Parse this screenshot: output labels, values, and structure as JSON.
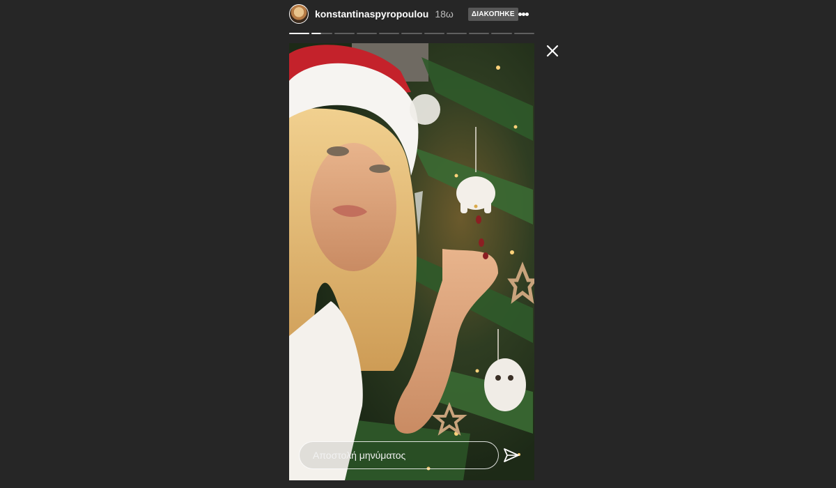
{
  "story": {
    "username": "konstantinaspyropoulou",
    "time_ago": "18ω",
    "paused_badge": "ΔΙΑΚΟΠΗΚΕ",
    "segments_total": 11,
    "current_segment": 2,
    "current_segment_progress": 0.45
  },
  "reply": {
    "placeholder": "Αποστολή μηνύματος"
  },
  "icons": {
    "more": "more-dots-icon",
    "close": "close-icon",
    "send": "send-icon"
  },
  "colors": {
    "background": "#262626",
    "badge": "#585858",
    "progress_done": "#ffffff",
    "progress_pending": "#5f5f5f"
  }
}
